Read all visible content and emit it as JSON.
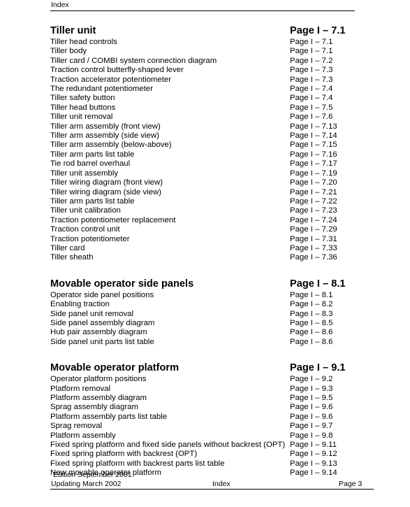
{
  "header": {
    "text": "Index"
  },
  "sections": [
    {
      "heading": {
        "title": "Tiller unit",
        "page": "Page I – 7.1"
      },
      "entries": [
        {
          "title": "Tiller head controls",
          "page": "Page I – 7.1"
        },
        {
          "title": "Tiller body",
          "page": "Page I – 7.1"
        },
        {
          "title": "Tiller card / COMBI system connection diagram",
          "page": "Page I – 7.2"
        },
        {
          "title": "Traction control butterfly-shaped lever",
          "page": "Page I – 7.3"
        },
        {
          "title": "Traction accelerator potentiometer",
          "page": "Page I – 7.3"
        },
        {
          "title": "The redundant potentiometer",
          "page": "Page I – 7.4"
        },
        {
          "title": "Tiller safety button",
          "page": "Page I – 7.4"
        },
        {
          "title": "Tiller head buttons",
          "page": "Page I – 7.5"
        },
        {
          "title": "Tiller unit removal",
          "page": "Page I – 7.6"
        },
        {
          "title": "Tiller arm assembly (front view)",
          "page": "Page I – 7.13"
        },
        {
          "title": "Tiller arm assembly (side view)",
          "page": "Page I – 7.14"
        },
        {
          "title": "Tiller arm assembly (below-above)",
          "page": "Page I – 7.15"
        },
        {
          "title": "Tiller arm parts list table",
          "page": "Page I – 7.16"
        },
        {
          "title": "Tie rod barrel overhaul",
          "page": "Page I – 7.17"
        },
        {
          "title": "Tiller unit assembly",
          "page": "Page I – 7.19"
        },
        {
          "title": "Tiller wiring diagram (front view)",
          "page": "Page I – 7.20"
        },
        {
          "title": "Tiller wiring diagram (side view)",
          "page": "Page I – 7.21"
        },
        {
          "title": "Tiller arm parts list table",
          "page": "Page I – 7.22"
        },
        {
          "title": "Tiller unit calibration",
          "page": "Page I – 7.23"
        },
        {
          "title": "Traction potentiometer replacement",
          "page": "Page I – 7.24"
        },
        {
          "title": "Traction control unit",
          "page": "Page I – 7.29"
        },
        {
          "title": "Traction potentiometer",
          "page": "Page I – 7.31"
        },
        {
          "title": "Tiller card",
          "page": "Page I – 7.33"
        },
        {
          "title": "Tiller sheath",
          "page": "Page I – 7.36"
        }
      ]
    },
    {
      "heading": {
        "title": "Movable operator side panels",
        "page": "Page I – 8.1"
      },
      "entries": [
        {
          "title": "Operator side panel positions",
          "page": "Page I – 8.1"
        },
        {
          "title": "Enabling traction",
          "page": "Page I – 8.2"
        },
        {
          "title": "Side panel unit removal",
          "page": "Page I – 8.3"
        },
        {
          "title": "Side panel assembly diagram",
          "page": "Page I – 8.5"
        },
        {
          "title": "Hub pair assembly diagram",
          "page": "Page I – 8.6"
        },
        {
          "title": "Side panel unit parts list table",
          "page": "Page I – 8.6"
        }
      ]
    },
    {
      "heading": {
        "title": "Movable operator platform",
        "page": "Page I – 9.1"
      },
      "entries": [
        {
          "title": "Operator platform positions",
          "page": "Page I – 9.2"
        },
        {
          "title": "Platform removal",
          "page": "Page I – 9.3"
        },
        {
          "title": "Platform assembly diagram",
          "page": "Page I – 9.5"
        },
        {
          "title": "Sprag assembly diagram",
          "page": "Page I – 9.6"
        },
        {
          "title": "Platform assembly parts list table",
          "page": "Page I – 9.6"
        },
        {
          "title": "Sprag removal",
          "page": "Page I – 9.7"
        },
        {
          "title": "Platform assembly",
          "page": "Page I – 9.8"
        },
        {
          "title": "Fixed spring platform and fixed side panels without backrest (OPT)",
          "page": "Page I – 9.11",
          "wrapped": true
        },
        {
          "title": "Fixed spring platform with backrest (OPT)",
          "page": "Page I – 9.12"
        },
        {
          "title": "Fixed spring platform with backrest parts list table",
          "page": "Page I – 9.13"
        },
        {
          "title": "New movable operator platform",
          "page": "Page I – 9.14"
        }
      ]
    }
  ],
  "footer": {
    "edition": "Edition September 2001",
    "updating": "Updating March 2002",
    "center": "Index",
    "page": "Page 3"
  }
}
